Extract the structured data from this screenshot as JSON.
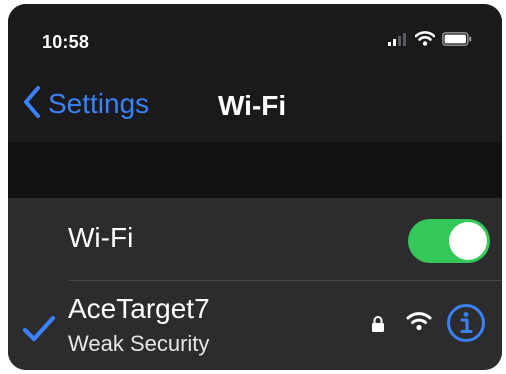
{
  "status_bar": {
    "time": "10:58",
    "icons": [
      "cellular-signal-icon",
      "wifi-status-icon",
      "battery-icon"
    ]
  },
  "nav": {
    "back_label": "Settings",
    "title": "Wi-Fi"
  },
  "wifi_toggle": {
    "label": "Wi-Fi",
    "on": true
  },
  "network": {
    "name": "AceTarget7",
    "security_note": "Weak Security",
    "connected": true,
    "secured": true,
    "signal_level": "full"
  },
  "colors": {
    "accent": "#3a82f7",
    "toggle_on": "#34c759",
    "background": "#1c1c1e",
    "cell": "#2c2c2e"
  }
}
